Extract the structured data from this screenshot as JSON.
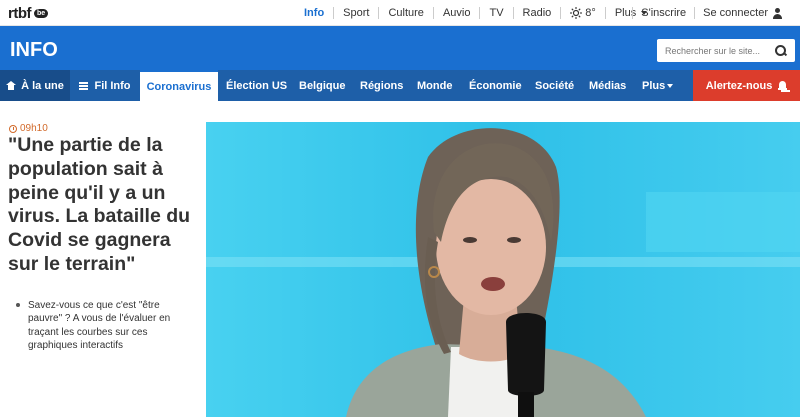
{
  "brand": {
    "logo_text": "rtbf",
    "logo_badge": "be"
  },
  "topnav": {
    "items": [
      {
        "label": "Info",
        "active": true
      },
      {
        "label": "Sport"
      },
      {
        "label": "Culture"
      },
      {
        "label": "Auvio"
      },
      {
        "label": "TV"
      },
      {
        "label": "Radio"
      },
      {
        "label": "8°",
        "icon": "sun-icon"
      },
      {
        "label": "Plus",
        "icon": "chevron-down-icon"
      }
    ],
    "signup": "S'inscrire",
    "login": "Se connecter"
  },
  "header": {
    "title": "INFO",
    "search_placeholder": "Rechercher sur le site..."
  },
  "nav": {
    "home": "À la une",
    "fil": "Fil Info",
    "items": [
      "Coronavirus",
      "Élection US",
      "Belgique",
      "Régions",
      "Monde",
      "Économie",
      "Société",
      "Médias",
      "Plus"
    ],
    "alert": "Alertez-nous"
  },
  "article": {
    "time": "09h10",
    "headline": "\"Une partie de la population sait à peine qu'il y a un virus. La bataille du Covid se gagnera sur le terrain\"",
    "related": "Savez-vous ce que c'est \"être pauvre\" ? A vous de l'évaluer en traçant les courbes sur ces graphiques interactifs"
  },
  "colors": {
    "brand_blue": "#1a6fd0",
    "nav_blue": "#1e5fa8",
    "alert_red": "#dc3d2c",
    "time_orange": "#d26a2b",
    "studio_cyan": "#3bc7ea"
  }
}
